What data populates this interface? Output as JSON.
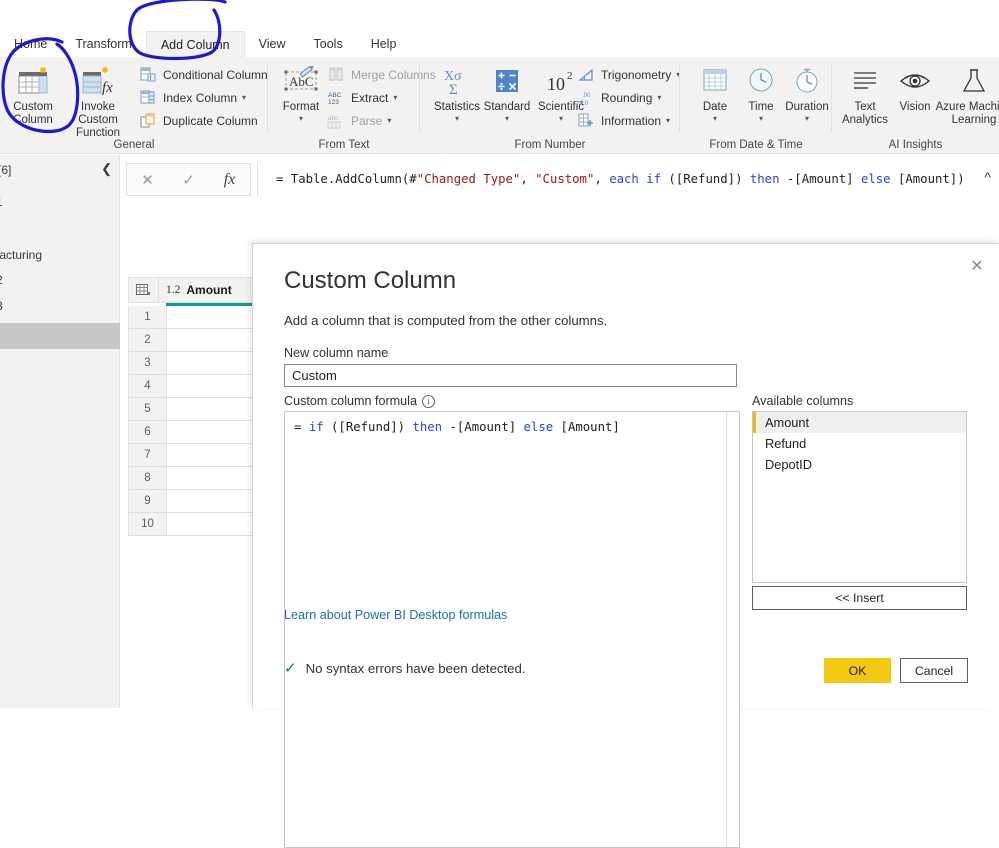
{
  "ribbon": {
    "tabs": [
      {
        "label": "Home",
        "active": false
      },
      {
        "label": "Transform",
        "active": false
      },
      {
        "label": "Add Column",
        "active": true
      },
      {
        "label": "View",
        "active": false
      },
      {
        "label": "Tools",
        "active": false
      },
      {
        "label": "Help",
        "active": false
      }
    ],
    "groups": [
      {
        "name": "General",
        "big_buttons": [
          {
            "label_line1": "Custom",
            "label_line2": "Column",
            "icon": "custom-column-icon",
            "caret": false
          },
          {
            "label_line1": "Invoke Custom",
            "label_line2": "Function",
            "icon": "invoke-custom-function-icon",
            "caret": false
          }
        ],
        "small_buttons": [
          {
            "label": "Conditional Column",
            "icon": "conditional-column-icon",
            "caret": false,
            "disabled": false
          },
          {
            "label": "Index Column",
            "icon": "index-column-icon",
            "caret": true,
            "disabled": false
          },
          {
            "label": "Duplicate Column",
            "icon": "duplicate-column-icon",
            "caret": false,
            "disabled": false
          }
        ]
      },
      {
        "name": "From Text",
        "big_buttons": [
          {
            "label_line1": "Format",
            "label_line2": "",
            "icon": "format-abc-icon",
            "caret": true
          }
        ],
        "small_buttons": [
          {
            "label": "Merge Columns",
            "icon": "merge-columns-icon",
            "caret": false,
            "disabled": true
          },
          {
            "label": "Extract",
            "icon": "extract-abc123-icon",
            "caret": true,
            "disabled": false
          },
          {
            "label": "Parse",
            "icon": "parse-icon",
            "caret": true,
            "disabled": true
          }
        ]
      },
      {
        "name": "From Number",
        "big_buttons": [
          {
            "label_line1": "Statistics",
            "label_line2": "",
            "icon": "statistics-sigma-icon",
            "caret": true
          },
          {
            "label_line1": "Standard",
            "label_line2": "",
            "icon": "standard-operators-icon",
            "caret": true
          },
          {
            "label_line1": "Scientific",
            "label_line2": "",
            "icon": "scientific-power-icon",
            "caret": true
          }
        ],
        "small_buttons": [
          {
            "label": "Trigonometry",
            "icon": "trigonometry-icon",
            "caret": true,
            "disabled": false
          },
          {
            "label": "Rounding",
            "icon": "rounding-icon",
            "caret": true,
            "disabled": false
          },
          {
            "label": "Information",
            "icon": "information-icon",
            "caret": true,
            "disabled": false
          }
        ]
      },
      {
        "name": "From Date & Time",
        "big_buttons": [
          {
            "label_line1": "Date",
            "label_line2": "",
            "icon": "calendar-icon",
            "caret": true
          },
          {
            "label_line1": "Time",
            "label_line2": "",
            "icon": "clock-icon",
            "caret": true
          },
          {
            "label_line1": "Duration",
            "label_line2": "",
            "icon": "stopwatch-icon",
            "caret": true
          }
        ],
        "small_buttons": []
      },
      {
        "name": "AI Insights",
        "big_buttons": [
          {
            "label_line1": "Text",
            "label_line2": "Analytics",
            "icon": "text-analytics-icon",
            "caret": false
          },
          {
            "label_line1": "Vision",
            "label_line2": "",
            "icon": "vision-eye-icon",
            "caret": false
          },
          {
            "label_line1": "Azure Machine",
            "label_line2": "Learning",
            "icon": "azure-ml-flask-icon",
            "caret": false
          }
        ],
        "small_buttons": []
      }
    ]
  },
  "queries_pane": {
    "title": "[6]",
    "collapse_icon": "chevron-left-icon",
    "items": [
      {
        "label": "1",
        "selected": false
      },
      {
        "label": "-",
        "selected": false
      },
      {
        "label": "facturing",
        "selected": false
      },
      {
        "label": "2",
        "selected": false
      },
      {
        "label": "3",
        "selected": false
      },
      {
        "label": "",
        "selected": true
      }
    ]
  },
  "formula_bar": {
    "cancel_icon": "cancel-x-icon",
    "accept_icon": "accept-check-icon",
    "fx_icon": "fx-icon",
    "expand_icon": "chevron-up-icon",
    "tokens": [
      {
        "text": "= Table.AddColumn(#",
        "type": "plain"
      },
      {
        "text": "\"Changed Type\"",
        "type": "string"
      },
      {
        "text": ", ",
        "type": "plain"
      },
      {
        "text": "\"Custom\"",
        "type": "string"
      },
      {
        "text": ", ",
        "type": "plain"
      },
      {
        "text": "each",
        "type": "keyword"
      },
      {
        "text": " ",
        "type": "plain"
      },
      {
        "text": "if",
        "type": "keyword"
      },
      {
        "text": " ([Refund]) ",
        "type": "plain"
      },
      {
        "text": "then",
        "type": "keyword"
      },
      {
        "text": " -[Amount] ",
        "type": "plain"
      },
      {
        "text": "else",
        "type": "keyword"
      },
      {
        "text": " [Amount])",
        "type": "plain"
      }
    ]
  },
  "data_grid": {
    "table_icon": "table-selector-icon",
    "column": {
      "type_badge": "1.2",
      "name": "Amount"
    },
    "accent_color": "#0f9b9b",
    "rows": [
      "1",
      "2",
      "3",
      "4",
      "5",
      "6",
      "7",
      "8",
      "9",
      "10"
    ]
  },
  "dialog": {
    "close_icon": "close-x-icon",
    "title": "Custom Column",
    "subtitle": "Add a column that is computed from the other columns.",
    "new_column_name_label": "New column name",
    "new_column_name_value": "Custom",
    "formula_label": "Custom column formula",
    "formula_info_icon": "info-circle-icon",
    "formula_tokens": [
      {
        "text": "= ",
        "type": "plain"
      },
      {
        "text": "if",
        "type": "keyword"
      },
      {
        "text": " ([Refund]) ",
        "type": "plain"
      },
      {
        "text": "then",
        "type": "keyword"
      },
      {
        "text": " -[Amount] ",
        "type": "plain"
      },
      {
        "text": "else",
        "type": "keyword"
      },
      {
        "text": " [Amount]",
        "type": "plain"
      }
    ],
    "learn_link": "Learn about Power BI Desktop formulas",
    "available_columns_label": "Available columns",
    "available_columns": [
      {
        "label": "Amount",
        "selected": true
      },
      {
        "label": "Refund",
        "selected": false
      },
      {
        "label": "DepotID",
        "selected": false
      }
    ],
    "insert_label": "<< Insert",
    "status_icon": "green-check-icon",
    "status_text": "No syntax errors have been detected.",
    "ok_label": "OK",
    "cancel_label": "Cancel",
    "ok_color": "#f2c811",
    "selected_accent_color": "#e8bc1c"
  },
  "annotations": {
    "color": "#1a1ad0",
    "shapes": [
      {
        "name": "circle-add-column-tab"
      },
      {
        "name": "circle-custom-column-button"
      }
    ]
  }
}
